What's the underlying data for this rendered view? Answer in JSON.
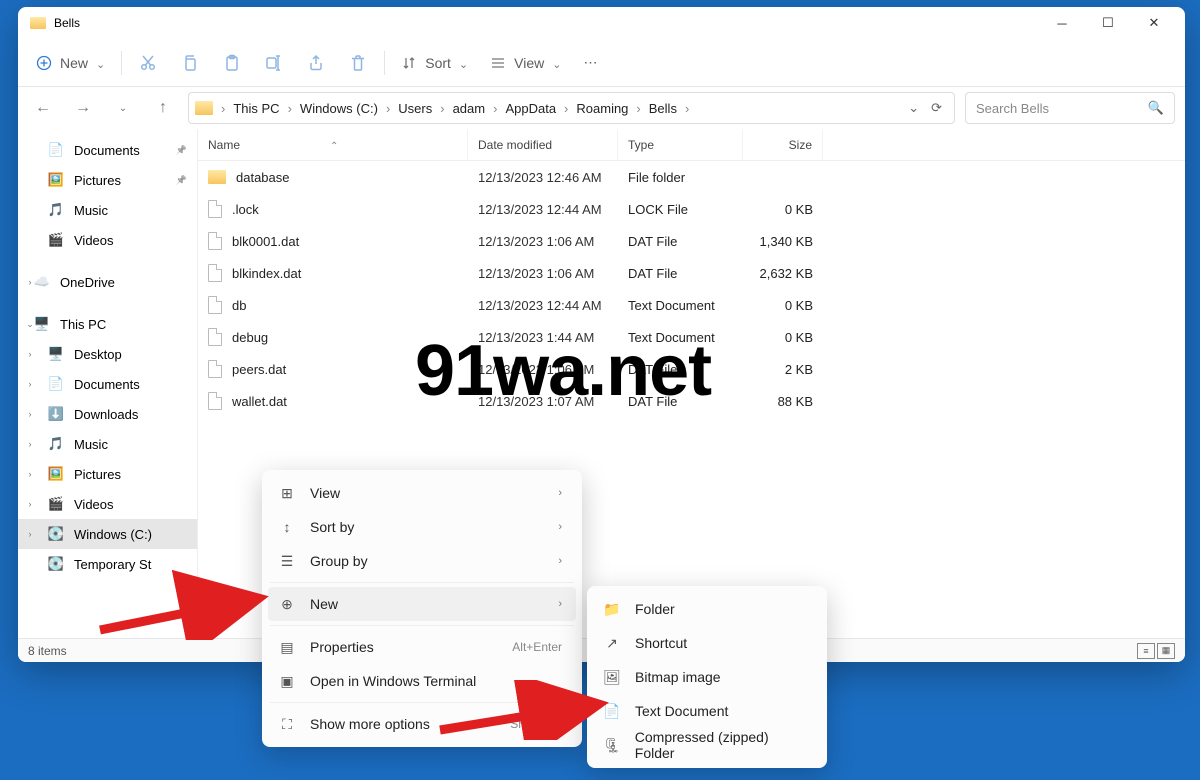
{
  "window": {
    "title": "Bells"
  },
  "toolbar": {
    "new": "New",
    "sort": "Sort",
    "view": "View"
  },
  "breadcrumb": [
    "This PC",
    "Windows (C:)",
    "Users",
    "adam",
    "AppData",
    "Roaming",
    "Bells"
  ],
  "search": {
    "placeholder": "Search Bells"
  },
  "columns": {
    "name": "Name",
    "date": "Date modified",
    "type": "Type",
    "size": "Size"
  },
  "quick": [
    {
      "label": "Documents",
      "pin": true
    },
    {
      "label": "Pictures",
      "pin": true
    },
    {
      "label": "Music",
      "pin": false
    },
    {
      "label": "Videos",
      "pin": false
    }
  ],
  "tree": {
    "onedrive": "OneDrive",
    "thispc": "This PC",
    "thispc_children": [
      "Desktop",
      "Documents",
      "Downloads",
      "Music",
      "Pictures",
      "Videos",
      "Windows (C:)",
      "Temporary St"
    ]
  },
  "files": [
    {
      "name": "database",
      "date": "12/13/2023 12:46 AM",
      "type": "File folder",
      "size": "",
      "icon": "folder"
    },
    {
      "name": ".lock",
      "date": "12/13/2023 12:44 AM",
      "type": "LOCK File",
      "size": "0 KB",
      "icon": "file"
    },
    {
      "name": "blk0001.dat",
      "date": "12/13/2023 1:06 AM",
      "type": "DAT File",
      "size": "1,340 KB",
      "icon": "file"
    },
    {
      "name": "blkindex.dat",
      "date": "12/13/2023 1:06 AM",
      "type": "DAT File",
      "size": "2,632 KB",
      "icon": "file"
    },
    {
      "name": "db",
      "date": "12/13/2023 12:44 AM",
      "type": "Text Document",
      "size": "0 KB",
      "icon": "file"
    },
    {
      "name": "debug",
      "date": "12/13/2023 1:44 AM",
      "type": "Text Document",
      "size": "0 KB",
      "icon": "file"
    },
    {
      "name": "peers.dat",
      "date": "12/13/2023 1:06 AM",
      "type": "DAT File",
      "size": "2 KB",
      "icon": "file"
    },
    {
      "name": "wallet.dat",
      "date": "12/13/2023 1:07 AM",
      "type": "DAT File",
      "size": "88 KB",
      "icon": "file"
    }
  ],
  "status": {
    "count": "8 items"
  },
  "ctx1": {
    "view": "View",
    "sort": "Sort by",
    "group": "Group by",
    "new": "New",
    "properties": "Properties",
    "prop_hint": "Alt+Enter",
    "terminal": "Open in Windows Terminal",
    "more": "Show more options",
    "more_hint": "Shift+F10"
  },
  "ctx2": {
    "folder": "Folder",
    "shortcut": "Shortcut",
    "bitmap": "Bitmap image",
    "text": "Text Document",
    "zip": "Compressed (zipped) Folder"
  },
  "watermark": "91wa.net"
}
